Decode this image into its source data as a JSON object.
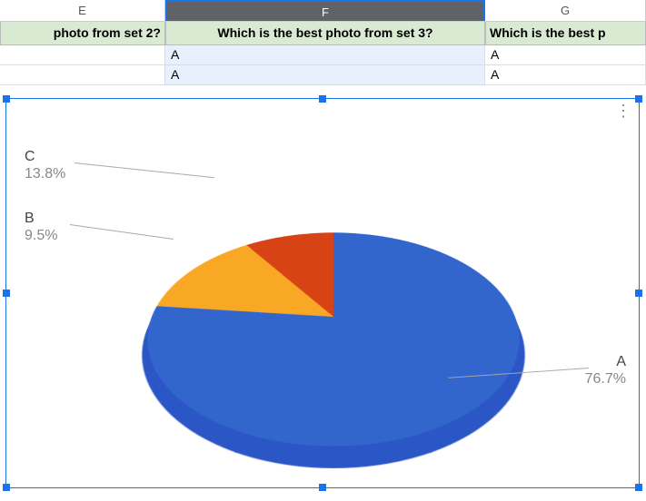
{
  "columns": {
    "e": "E",
    "f": "F",
    "g": "G"
  },
  "headers": {
    "e": "photo from set 2?",
    "f": "Which is the best photo from set 3?",
    "g": "Which is the best p"
  },
  "rows": [
    {
      "e": "",
      "f": "A",
      "g": "A"
    },
    {
      "e": "",
      "f": "A",
      "g": "A"
    }
  ],
  "chart_data": {
    "type": "pie",
    "title": "",
    "series": [
      {
        "name": "A",
        "value": 76.7,
        "label": "76.7%",
        "color": "#3366cc"
      },
      {
        "name": "C",
        "value": 13.8,
        "label": "13.8%",
        "color": "#f9a825"
      },
      {
        "name": "B",
        "value": 9.5,
        "label": "9.5%",
        "color": "#d84315"
      }
    ]
  }
}
